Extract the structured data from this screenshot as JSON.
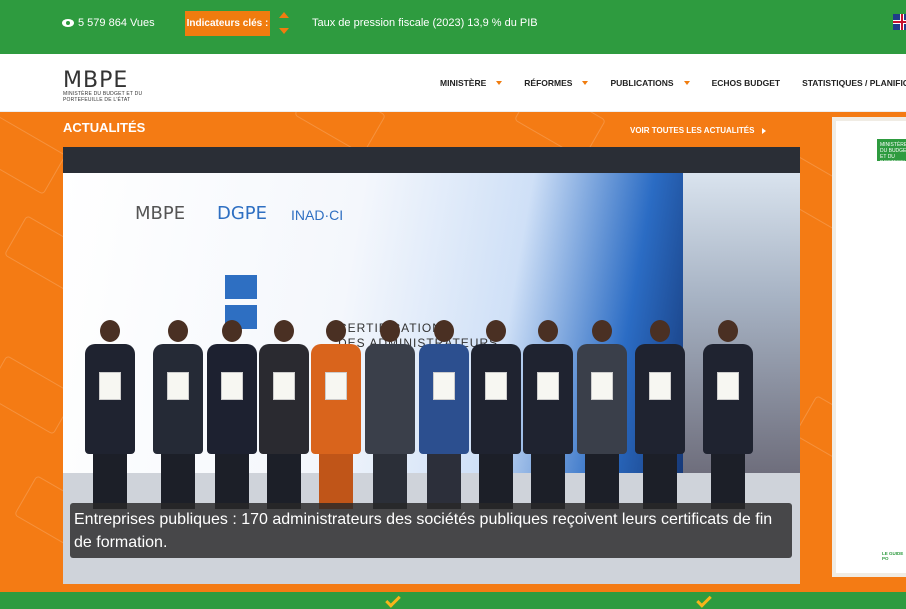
{
  "topbar": {
    "views_text": "5 579 864 Vues",
    "kpi_label": "Indicateurs clés :",
    "ticker_text": "Taux de pression fiscale (2023) 13,9 % du PIB",
    "language_flag": "english-flag-icon"
  },
  "logo": {
    "main": "MBPE",
    "subtitle": "MINISTÈRE DU BUDGET ET DU PORTEFEUILLE DE L'ÉTAT"
  },
  "nav": {
    "items": [
      {
        "label": "MINISTÈRE"
      },
      {
        "label": "RÉFORMES"
      },
      {
        "label": "PUBLICATIONS"
      },
      {
        "label": "ECHOS BUDGET"
      },
      {
        "label": "STATISTIQUES / PLANIFICA"
      }
    ]
  },
  "news": {
    "section_title": "ACTUALITÉS",
    "see_all": "VOIR TOUTES LES ACTUALITÉS",
    "caption": "Entreprises publiques : 170 administrateurs des sociétés publiques reçoivent leurs certificats de fin de formation.",
    "screen_logos": [
      "MBPE",
      "DGPE",
      "INAD·CI"
    ],
    "screen_text_1": "CERTIFICATION",
    "screen_text_2": "DES ADMINISTRATEURS",
    "sidecard_tag": "MINISTÈRE DU BUDGET ET DU PORTEFEUILLE",
    "sidecard_footer": "LE GUIDE PO"
  },
  "colors": {
    "green": "#2e9b3f",
    "orange": "#f47b14",
    "accent_orange": "#f07c0f",
    "yellow": "#f7b51a"
  }
}
